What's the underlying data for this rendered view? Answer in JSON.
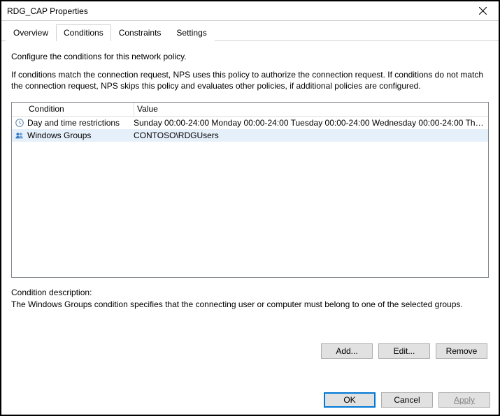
{
  "window": {
    "title": "RDG_CAP Properties"
  },
  "tabs": {
    "overview": "Overview",
    "conditions": "Conditions",
    "constraints": "Constraints",
    "settings": "Settings"
  },
  "intro": "Configure the conditions for this network policy.",
  "explain": "If conditions match the connection request, NPS uses this policy to authorize the connection request. If conditions do not match the connection request, NPS skips this policy and evaluates other policies, if additional policies are configured.",
  "columns": {
    "condition": "Condition",
    "value": "Value"
  },
  "rows": [
    {
      "icon": "clock-icon",
      "condition": "Day and time restrictions",
      "value": "Sunday 00:00-24:00 Monday 00:00-24:00 Tuesday 00:00-24:00 Wednesday 00:00-24:00 Thursd..."
    },
    {
      "icon": "group-icon",
      "condition": "Windows Groups",
      "value": "CONTOSO\\RDGUsers"
    }
  ],
  "description": {
    "label": "Condition description:",
    "text": "The Windows Groups condition specifies that the connecting user or computer must belong to one of the selected groups."
  },
  "buttons": {
    "add": "Add...",
    "edit": "Edit...",
    "remove": "Remove",
    "ok": "OK",
    "cancel": "Cancel",
    "apply": "Apply"
  }
}
